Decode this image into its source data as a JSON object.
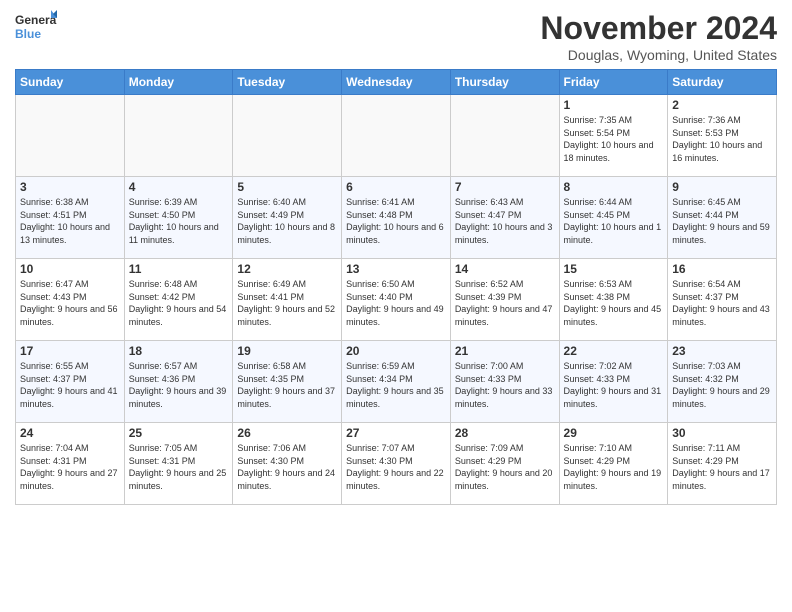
{
  "header": {
    "logo_general": "General",
    "logo_blue": "Blue",
    "month": "November 2024",
    "location": "Douglas, Wyoming, United States"
  },
  "weekdays": [
    "Sunday",
    "Monday",
    "Tuesday",
    "Wednesday",
    "Thursday",
    "Friday",
    "Saturday"
  ],
  "weeks": [
    [
      {
        "day": "",
        "info": ""
      },
      {
        "day": "",
        "info": ""
      },
      {
        "day": "",
        "info": ""
      },
      {
        "day": "",
        "info": ""
      },
      {
        "day": "",
        "info": ""
      },
      {
        "day": "1",
        "info": "Sunrise: 7:35 AM\nSunset: 5:54 PM\nDaylight: 10 hours and 18 minutes."
      },
      {
        "day": "2",
        "info": "Sunrise: 7:36 AM\nSunset: 5:53 PM\nDaylight: 10 hours and 16 minutes."
      }
    ],
    [
      {
        "day": "3",
        "info": "Sunrise: 6:38 AM\nSunset: 4:51 PM\nDaylight: 10 hours and 13 minutes."
      },
      {
        "day": "4",
        "info": "Sunrise: 6:39 AM\nSunset: 4:50 PM\nDaylight: 10 hours and 11 minutes."
      },
      {
        "day": "5",
        "info": "Sunrise: 6:40 AM\nSunset: 4:49 PM\nDaylight: 10 hours and 8 minutes."
      },
      {
        "day": "6",
        "info": "Sunrise: 6:41 AM\nSunset: 4:48 PM\nDaylight: 10 hours and 6 minutes."
      },
      {
        "day": "7",
        "info": "Sunrise: 6:43 AM\nSunset: 4:47 PM\nDaylight: 10 hours and 3 minutes."
      },
      {
        "day": "8",
        "info": "Sunrise: 6:44 AM\nSunset: 4:45 PM\nDaylight: 10 hours and 1 minute."
      },
      {
        "day": "9",
        "info": "Sunrise: 6:45 AM\nSunset: 4:44 PM\nDaylight: 9 hours and 59 minutes."
      }
    ],
    [
      {
        "day": "10",
        "info": "Sunrise: 6:47 AM\nSunset: 4:43 PM\nDaylight: 9 hours and 56 minutes."
      },
      {
        "day": "11",
        "info": "Sunrise: 6:48 AM\nSunset: 4:42 PM\nDaylight: 9 hours and 54 minutes."
      },
      {
        "day": "12",
        "info": "Sunrise: 6:49 AM\nSunset: 4:41 PM\nDaylight: 9 hours and 52 minutes."
      },
      {
        "day": "13",
        "info": "Sunrise: 6:50 AM\nSunset: 4:40 PM\nDaylight: 9 hours and 49 minutes."
      },
      {
        "day": "14",
        "info": "Sunrise: 6:52 AM\nSunset: 4:39 PM\nDaylight: 9 hours and 47 minutes."
      },
      {
        "day": "15",
        "info": "Sunrise: 6:53 AM\nSunset: 4:38 PM\nDaylight: 9 hours and 45 minutes."
      },
      {
        "day": "16",
        "info": "Sunrise: 6:54 AM\nSunset: 4:37 PM\nDaylight: 9 hours and 43 minutes."
      }
    ],
    [
      {
        "day": "17",
        "info": "Sunrise: 6:55 AM\nSunset: 4:37 PM\nDaylight: 9 hours and 41 minutes."
      },
      {
        "day": "18",
        "info": "Sunrise: 6:57 AM\nSunset: 4:36 PM\nDaylight: 9 hours and 39 minutes."
      },
      {
        "day": "19",
        "info": "Sunrise: 6:58 AM\nSunset: 4:35 PM\nDaylight: 9 hours and 37 minutes."
      },
      {
        "day": "20",
        "info": "Sunrise: 6:59 AM\nSunset: 4:34 PM\nDaylight: 9 hours and 35 minutes."
      },
      {
        "day": "21",
        "info": "Sunrise: 7:00 AM\nSunset: 4:33 PM\nDaylight: 9 hours and 33 minutes."
      },
      {
        "day": "22",
        "info": "Sunrise: 7:02 AM\nSunset: 4:33 PM\nDaylight: 9 hours and 31 minutes."
      },
      {
        "day": "23",
        "info": "Sunrise: 7:03 AM\nSunset: 4:32 PM\nDaylight: 9 hours and 29 minutes."
      }
    ],
    [
      {
        "day": "24",
        "info": "Sunrise: 7:04 AM\nSunset: 4:31 PM\nDaylight: 9 hours and 27 minutes."
      },
      {
        "day": "25",
        "info": "Sunrise: 7:05 AM\nSunset: 4:31 PM\nDaylight: 9 hours and 25 minutes."
      },
      {
        "day": "26",
        "info": "Sunrise: 7:06 AM\nSunset: 4:30 PM\nDaylight: 9 hours and 24 minutes."
      },
      {
        "day": "27",
        "info": "Sunrise: 7:07 AM\nSunset: 4:30 PM\nDaylight: 9 hours and 22 minutes."
      },
      {
        "day": "28",
        "info": "Sunrise: 7:09 AM\nSunset: 4:29 PM\nDaylight: 9 hours and 20 minutes."
      },
      {
        "day": "29",
        "info": "Sunrise: 7:10 AM\nSunset: 4:29 PM\nDaylight: 9 hours and 19 minutes."
      },
      {
        "day": "30",
        "info": "Sunrise: 7:11 AM\nSunset: 4:29 PM\nDaylight: 9 hours and 17 minutes."
      }
    ]
  ]
}
